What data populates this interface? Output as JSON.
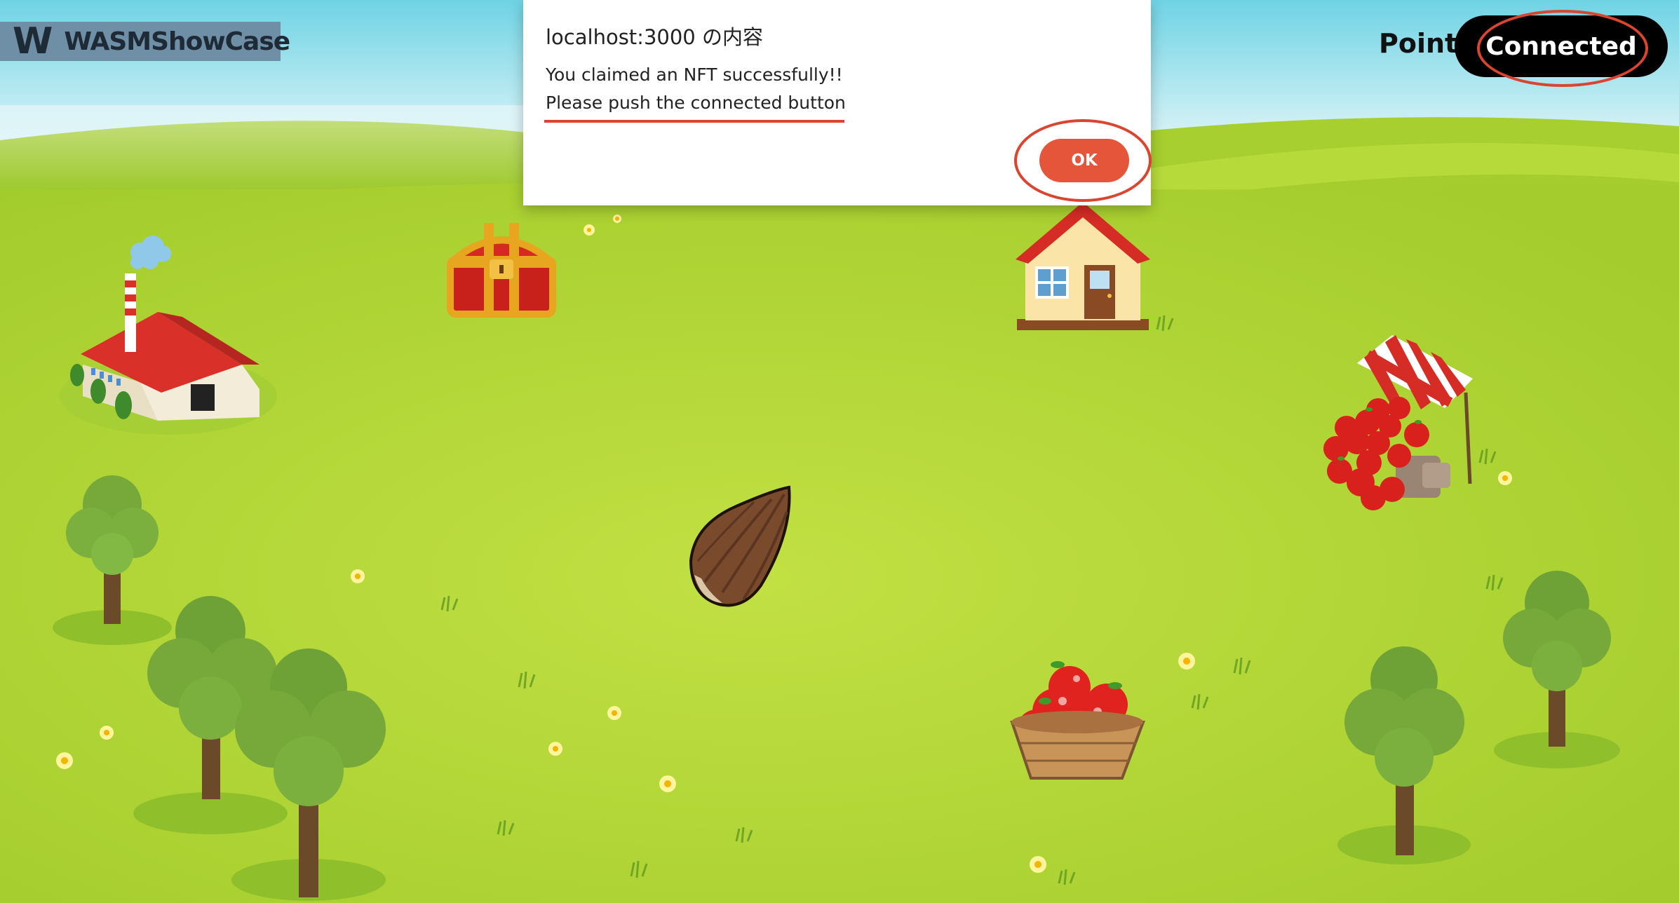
{
  "logo": {
    "mark": "W",
    "text": "WASMShowCase"
  },
  "header": {
    "point_label": "Point",
    "connected_label": "Connected"
  },
  "dialog": {
    "title": "localhost:3000 の内容",
    "message_line1": "You claimed an NFT successfully!!",
    "message_line2": "Please push the connected button",
    "ok_label": "OK"
  },
  "colors": {
    "sky_top": "#7fd9e6",
    "grass": "#b9dd3c",
    "annotation": "#d9452e",
    "ok_button": "#e5553a",
    "connected_button": "#000000"
  },
  "scene_objects": [
    "factory-icon",
    "treasure-chest-icon",
    "house-icon",
    "apple-stand-icon",
    "seed-icon",
    "apple-basket-icon"
  ]
}
